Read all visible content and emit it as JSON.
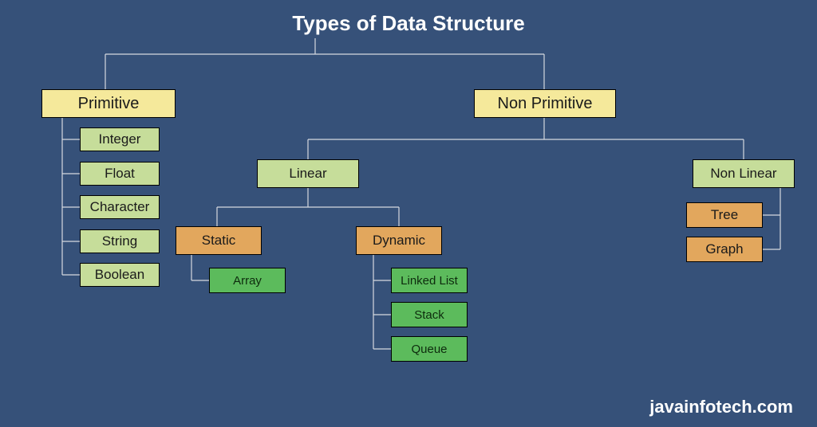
{
  "title": "Types of Data Structure",
  "watermark": "javainfotech.com",
  "root": {
    "primitive": {
      "label": "Primitive",
      "children": [
        "Integer",
        "Float",
        "Character",
        "String",
        "Boolean"
      ]
    },
    "non_primitive": {
      "label": "Non Primitive",
      "linear": {
        "label": "Linear",
        "static": {
          "label": "Static",
          "children": [
            "Array"
          ]
        },
        "dynamic": {
          "label": "Dynamic",
          "children": [
            "Linked List",
            "Stack",
            "Queue"
          ]
        }
      },
      "non_linear": {
        "label": "Non Linear",
        "children": [
          "Tree",
          "Graph"
        ]
      }
    }
  }
}
